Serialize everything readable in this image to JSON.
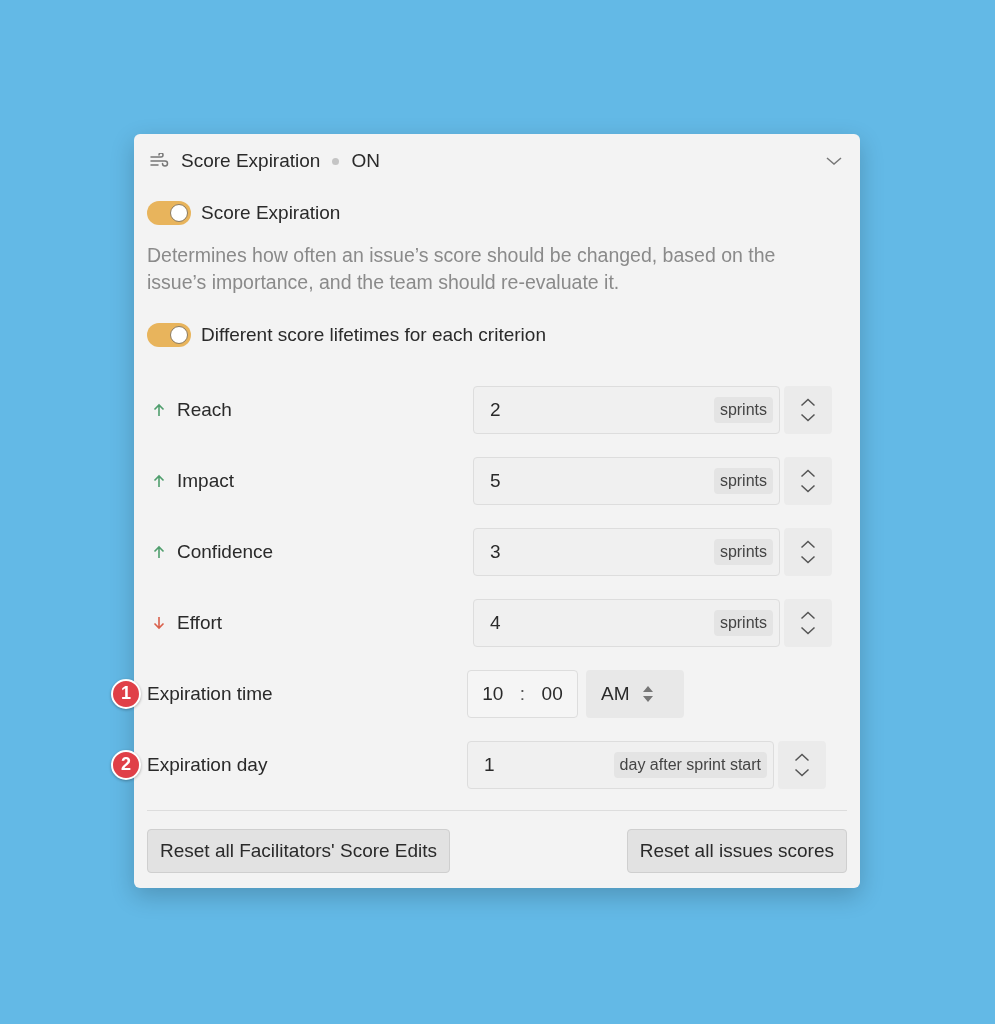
{
  "header": {
    "title": "Score Expiration",
    "status": "ON",
    "expanded": true
  },
  "toggles": [
    {
      "label": "Score Expiration",
      "on": true,
      "description": "Determines how often an issue’s score should be changed, based on the issue’s importance, and the team should re-evaluate it."
    },
    {
      "label": "Different score lifetimes for each criterion",
      "on": true
    }
  ],
  "criteria": [
    {
      "kind": "up",
      "label": "Reach",
      "value": "2",
      "unit": "sprints"
    },
    {
      "kind": "up",
      "label": "Impact",
      "value": "5",
      "unit": "sprints"
    },
    {
      "kind": "up",
      "label": "Confidence",
      "value": "3",
      "unit": "sprints"
    },
    {
      "kind": "down",
      "label": "Effort",
      "value": "4",
      "unit": "sprints"
    }
  ],
  "expiration_time": {
    "marker": "1",
    "label": "Expiration time",
    "hour": "10",
    "colon": ":",
    "minute": "00",
    "period": "AM"
  },
  "expiration_day": {
    "marker": "2",
    "label": "Expiration day",
    "value": "1",
    "unit": "day after sprint start"
  },
  "buttons": [
    "Reset all Facilitators' Score Edits",
    "Reset all issues scores"
  ]
}
